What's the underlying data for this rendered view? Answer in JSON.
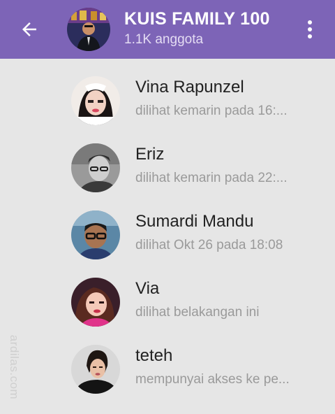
{
  "header": {
    "title": "KUIS FAMILY 100",
    "subtitle": "1.1K anggota",
    "back_icon": "arrow-left-icon",
    "menu_icon": "more-vertical-icon",
    "background_color": "#7d64b7"
  },
  "members": [
    {
      "name": "Vina Rapunzel",
      "status": "dilihat kemarin pada 16:..."
    },
    {
      "name": "Eriz",
      "status": "dilihat kemarin pada 22:..."
    },
    {
      "name": "Sumardi Mandu",
      "status": "dilihat Okt 26 pada 18:08"
    },
    {
      "name": "Via",
      "status": "dilihat belakangan ini"
    },
    {
      "name": "teteh",
      "status": "mempunyai akses ke pe..."
    }
  ],
  "watermark": "ardilas.com"
}
